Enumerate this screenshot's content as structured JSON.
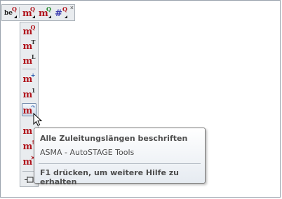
{
  "horizontal_toolbar": {
    "buttons": [
      {
        "icon": "label-text-icon",
        "text": "be",
        "sup": "Q"
      },
      {
        "icon": "label-m-q-icon",
        "text": "m",
        "sup": "Q"
      },
      {
        "icon": "label-m-q-green-icon",
        "text": "m",
        "sup": "Q"
      },
      {
        "icon": "label-number-icon",
        "text": "#",
        "sup": "Q"
      }
    ],
    "close_glyph": "×"
  },
  "vertical_toolbar": {
    "buttons": [
      {
        "icon": "label-m-q-icon",
        "text": "m",
        "sup": "Q"
      },
      {
        "icon": "label-m-t-icon",
        "text": "m",
        "sup": "T"
      },
      {
        "icon": "label-m-l-icon",
        "text": "m",
        "sup": "L"
      },
      {
        "icon": "label-m-plus-icon",
        "text": "m",
        "sup": "+"
      },
      {
        "icon": "label-m-1-icon",
        "text": "m",
        "sup": "1"
      },
      {
        "icon": "label-all-leads-icon",
        "text": "m",
        "sup": "↷"
      },
      {
        "icon": "label-m-red-icon",
        "text": "m",
        "sup": ""
      },
      {
        "icon": "label-m-red-t-icon",
        "text": "m",
        "sup": "↑"
      },
      {
        "icon": "label-m-red-x-icon",
        "text": "m",
        "sup": "✕"
      }
    ],
    "bottom_icon": "pin-icon"
  },
  "tooltip": {
    "title": "Alle Zuleitungslängen beschriften",
    "subtitle": "ASMA - AutoSTAGE Tools",
    "help": "F1 drücken, um weitere Hilfe zu erhalten"
  },
  "colors": {
    "icon_red": "#b0141c",
    "toolbar_bg": "#e9ecef",
    "tooltip_text": "#4c4c4c"
  }
}
